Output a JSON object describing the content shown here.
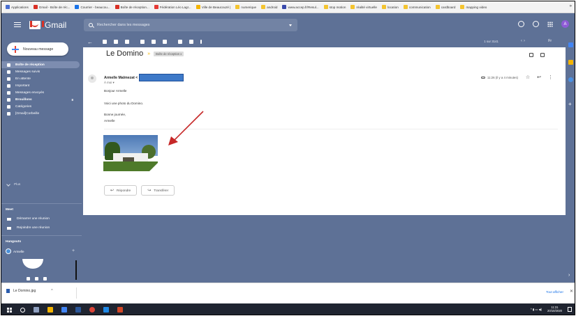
{
  "bookmarks": [
    {
      "label": "Applications",
      "color": "#4a6fd1"
    },
    {
      "label": "Gmail - Boîte de réc...",
      "color": "#d93025"
    },
    {
      "label": "Courrier - beaucou...",
      "color": "#1a73e8"
    },
    {
      "label": "Boîte de réception...",
      "color": "#d93025"
    },
    {
      "label": "Fédération Léo Lagr...",
      "color": "#e53935"
    },
    {
      "label": "Ville de Beaucouzé |",
      "color": "#f4b400"
    },
    {
      "label": "numerique",
      "color": "#f4c430"
    },
    {
      "label": "android",
      "color": "#f4c430"
    },
    {
      "label": "www.accep.fr/Resul...",
      "color": "#3949ab"
    },
    {
      "label": "stop motion",
      "color": "#f4c430"
    },
    {
      "label": "réalité virtuelle",
      "color": "#f4c430"
    },
    {
      "label": "location",
      "color": "#f4c430"
    },
    {
      "label": "communication",
      "color": "#f4c430"
    },
    {
      "label": "cardboard",
      "color": "#f4c430"
    },
    {
      "label": "mapping video",
      "color": "#f4c430"
    }
  ],
  "bookmarks_more": "»",
  "app": {
    "name": "Gmail",
    "avatar_letter": "A"
  },
  "search": {
    "placeholder": "Rechercher dans les messages"
  },
  "compose": {
    "label": "Nouveau message"
  },
  "nav": [
    {
      "label": "Boîte de réception",
      "active": true
    },
    {
      "label": "Messages suivis"
    },
    {
      "label": "En attente"
    },
    {
      "label": "Important"
    },
    {
      "label": "Messages envoyés"
    },
    {
      "label": "Brouillons",
      "bold": true,
      "count": "8"
    },
    {
      "label": "Catégories"
    },
    {
      "label": "[Gmail]Corbeille"
    }
  ],
  "more_label": "Plus",
  "meet": {
    "title": "Meet",
    "start": "Démarrer une réunion",
    "join": "Rejoindre une réunion"
  },
  "hangouts": {
    "title": "Hangouts",
    "user": "Armelle"
  },
  "toolbar": {
    "count": "1 sur 3141",
    "nav": "‹   ›",
    "lang": "Fr"
  },
  "message": {
    "subject": "Le Domino",
    "label": "Boîte de réception x",
    "sender": "Armelle Malmezat",
    "to": "À moi",
    "time": "11:26 (il y a 4 minutes)",
    "lines": [
      "Bonjour Armelle",
      "Voici une photo du Domino.",
      "Bonne journée,",
      "Armelle"
    ]
  },
  "actions": {
    "reply": "Répondre",
    "forward": "Transférer"
  },
  "download": {
    "file": "Le Domino.jpg",
    "show_all": "Tout afficher"
  },
  "taskbar": {
    "time": "11:31",
    "date": "20/10/2020"
  },
  "colors": {
    "theme": "#5e7196",
    "accent_red": "#d93025",
    "arrow": "#c62828"
  }
}
